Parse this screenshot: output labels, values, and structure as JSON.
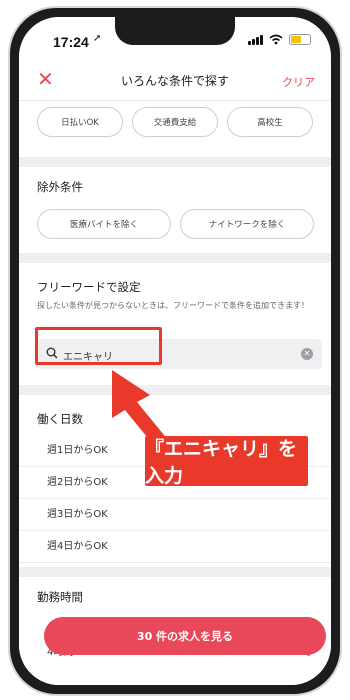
{
  "status_bar": {
    "time": "17:24"
  },
  "header": {
    "title": "いろんな条件で探す",
    "clear_label": "クリア",
    "close_icon": "close-icon"
  },
  "chips_top": [
    "日払いOK",
    "交通費支給",
    "高校生"
  ],
  "exclude": {
    "title": "除外条件",
    "chips": [
      "医療バイトを除く",
      "ナイトワークを除く"
    ]
  },
  "freeword": {
    "title": "フリーワードで設定",
    "note": "探したい条件が見つからないときは、フリーワードで条件を追加できます！",
    "value": "エニキャリ"
  },
  "workdays": {
    "title": "働く日数",
    "options": [
      "週1日からOK",
      "週2日からOK",
      "週3日からOK",
      "週4日からOK"
    ]
  },
  "hours": {
    "title": "勤務時間",
    "options": [
      "4時間"
    ]
  },
  "cta_label": "30 件の求人を見る",
  "annotation_text": "『エニキャリ』を入力",
  "colors": {
    "accent": "#e8485a",
    "annotation": "#e8392a"
  }
}
